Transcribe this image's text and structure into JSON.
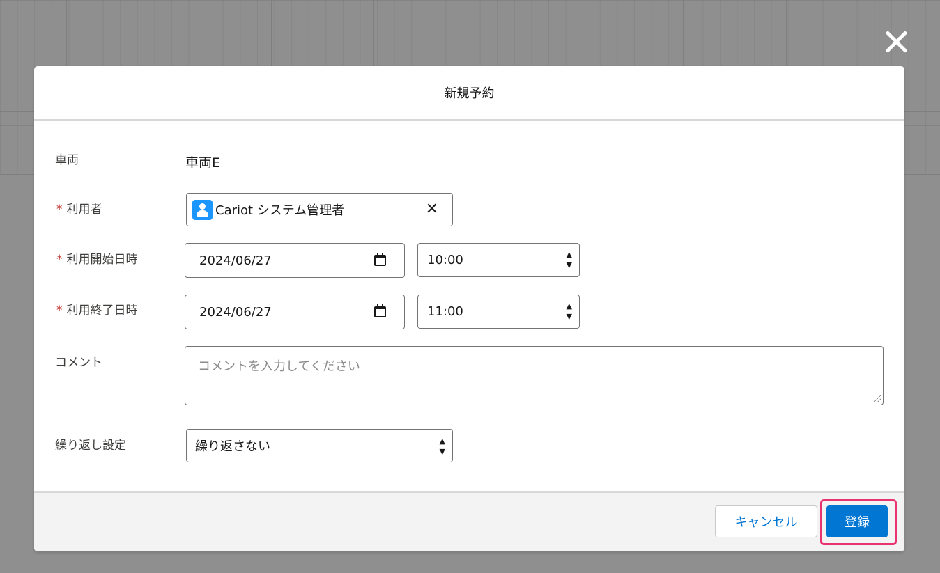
{
  "modal": {
    "title": "新規予約",
    "fields": {
      "vehicle": {
        "label": "車両",
        "value": "車両E"
      },
      "user": {
        "required_mark": "*",
        "label": "利用者",
        "value": "Cariot システム管理者",
        "clear": "✕"
      },
      "start": {
        "required_mark": "*",
        "label": "利用開始日時",
        "date": "2024/06/27",
        "time": "10:00"
      },
      "end": {
        "required_mark": "*",
        "label": "利用終了日時",
        "date": "2024/06/27",
        "time": "11:00"
      },
      "comment": {
        "label": "コメント",
        "placeholder": "コメントを入力してください"
      },
      "repeat": {
        "label": "繰り返し設定",
        "selected": "繰り返さない"
      }
    },
    "footer": {
      "cancel": "キャンセル",
      "save": "登録"
    }
  },
  "icons": {
    "close": "close-icon",
    "user": "user-avatar-icon",
    "calendar": "calendar-icon"
  },
  "colors": {
    "brand_blue": "#0176d3",
    "highlight": "#e8336e",
    "required": "#c23934",
    "avatar": "#1b96ff"
  }
}
